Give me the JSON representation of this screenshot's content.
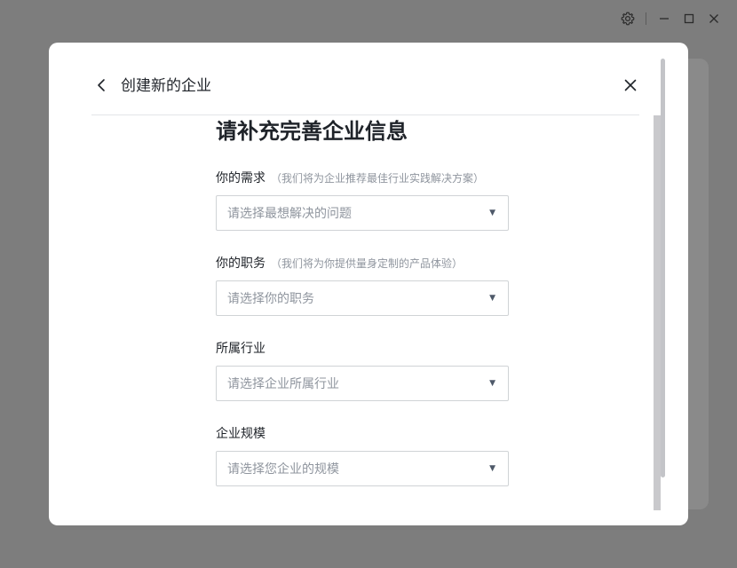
{
  "modal": {
    "title": "创建新的企业",
    "heading": "请补充完善企业信息"
  },
  "fields": [
    {
      "label": "你的需求",
      "hint": "（我们将为企业推荐最佳行业实践解决方案）",
      "placeholder": "请选择最想解决的问题"
    },
    {
      "label": "你的职务",
      "hint": "（我们将为你提供量身定制的产品体验）",
      "placeholder": "请选择你的职务"
    },
    {
      "label": "所属行业",
      "hint": "",
      "placeholder": "请选择企业所属行业"
    },
    {
      "label": "企业规模",
      "hint": "",
      "placeholder": "请选择您企业的规模"
    }
  ],
  "icons": {
    "caret": "▼"
  }
}
